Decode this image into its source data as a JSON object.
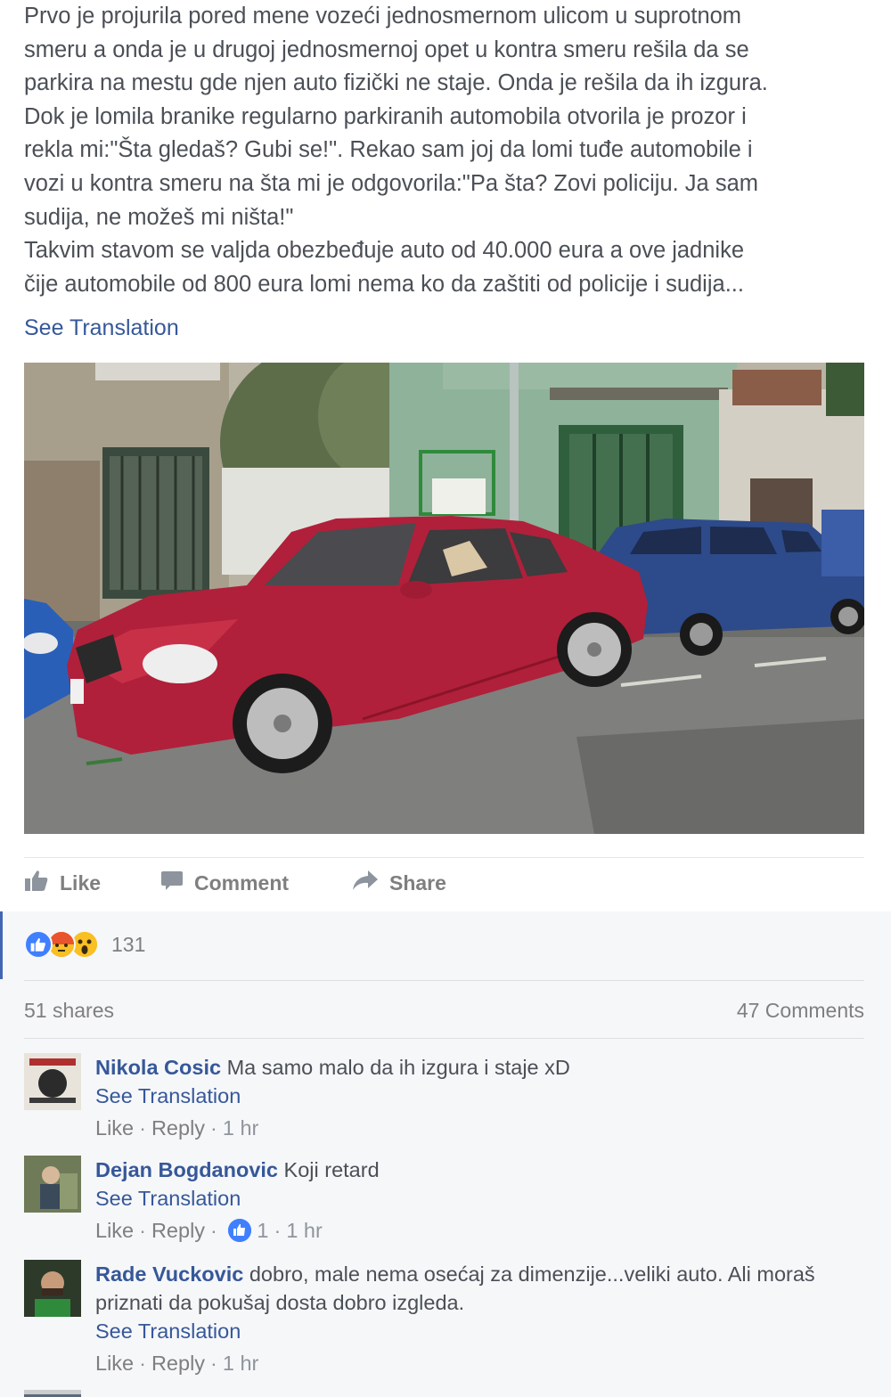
{
  "post": {
    "lines": [
      "Prvo je projurila pored mene vozeći jednosmernom ulicom u suprotnom",
      "smeru a onda je u drugoj jednosmernoj opet u kontra smeru rešila da se",
      "parkira na mestu gde njen auto fizički ne staje. Onda je rešila da ih izgura.",
      "Dok je lomila branike regularno parkiranih automobila otvorila je prozor i",
      "rekla mi:\"Šta gledaš? Gubi se!\". Rekao sam joj da lomi tuđe automobile i",
      "vozi u kontra smeru na šta mi je odgovorila:\"Pa šta? Zovi policiju. Ja sam",
      "sudija, ne možeš mi ništa!\"",
      "Takvim stavom se valjda obezbeđuje auto od 40.000 eura a ove jadnike",
      "čije automobile od 800 eura lomi nema ko da zaštiti od policije i sudija..."
    ],
    "see_translation": "See Translation"
  },
  "actions": {
    "like": "Like",
    "comment": "Comment",
    "share": "Share"
  },
  "reactions": {
    "icons": [
      "like-reaction-icon",
      "angry-reaction-icon",
      "wow-reaction-icon"
    ],
    "count": "131"
  },
  "stats": {
    "shares": "51 shares",
    "comments": "47 Comments"
  },
  "comments": [
    {
      "author": "Nikola Cosic",
      "text": "Ma samo malo da ih izgura i staje xD",
      "see_translation": "See Translation",
      "like": "Like",
      "reply": "Reply",
      "time": "1 hr",
      "likes": ""
    },
    {
      "author": "Dejan Bogdanovic",
      "text": "Koji retard",
      "see_translation": "See Translation",
      "like": "Like",
      "reply": "Reply",
      "time": "1 hr",
      "likes": "1"
    },
    {
      "author": "Rade Vuckovic",
      "text": "dobro, male nema osećaj za dimenzije...veliki auto. Ali moraš priznati da pokušaj dosta dobro izgleda.",
      "see_translation": "See Translation",
      "like": "Like",
      "reply": "Reply",
      "time": "1 hr",
      "likes": ""
    }
  ],
  "colors": {
    "link": "#365899",
    "text": "#4b4f56",
    "muted": "#90949c",
    "accent": "#4267b2",
    "car_red": "#b0203a",
    "car_blue": "#2d4a8a"
  }
}
